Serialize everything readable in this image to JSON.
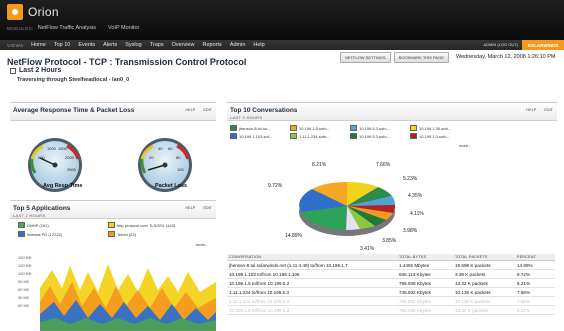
{
  "app": {
    "name": "Orion"
  },
  "modules": {
    "label": "MODULES:",
    "items": [
      "NetFlow Traffic Analysis",
      "VoIP Monitor"
    ]
  },
  "views": {
    "label": "VIEWS:",
    "items": [
      "Home",
      "Top 10",
      "Events",
      "Alerts",
      "Syslog",
      "Traps",
      "Overview",
      "Reports",
      "Admin",
      "Help"
    ]
  },
  "session": {
    "admin": "ADMIN (LOG OUT)",
    "brand": "SOLARWINDS"
  },
  "page": {
    "title": "NetFlow Protocol - TCP : Transmission Control Protocol",
    "period": "Last 2 Hours",
    "through": "Traversing through Steelheadlocal - lan0_0",
    "date": "Wednesday, March 12, 2008 1:26:10 PM",
    "netflow_settings": "NETFLOW SETTINGS",
    "bookmark": "BOOKMARK THIS PAGE"
  },
  "panels": {
    "response": {
      "title": "Average Response Time & Packet Loss",
      "help": "HELP",
      "edit": "EDIT",
      "gauge1": {
        "label": "Avg Resp Time",
        "ticks": [
          "1000",
          "1500",
          "500",
          "2000",
          "2500"
        ]
      },
      "gauge2": {
        "label": "Packet Loss",
        "ticks": [
          "40",
          "60",
          "20",
          "80",
          "100"
        ]
      }
    },
    "conversations": {
      "title": "Top 10 Conversations",
      "subtitle": "LAST 2 HOURS",
      "help": "HELP",
      "edit": "EDIT",
      "more": "more...",
      "legend": [
        {
          "label": "jhenson-8.tul.so...",
          "color": "#2e8b45"
        },
        {
          "label": "10.199.1.5.sofo...",
          "color": "#f5a623"
        },
        {
          "label": "10.199.5.3.sofo...",
          "color": "#4fa3d8"
        },
        {
          "label": "10.199.1.30.sofr...",
          "color": "#f2d21b"
        },
        {
          "label": "10.199.1.103.sof...",
          "color": "#2f6fc9"
        },
        {
          "label": "1.11.1.234.sofo...",
          "color": "#8dc63f"
        },
        {
          "label": "10.199.5.3.sofo...",
          "color": "#1d7a3a"
        },
        {
          "label": "10.199.1.3.sofo...",
          "color": "#b22222"
        }
      ],
      "pie_labels": [
        "8.21%",
        "7.66%",
        "9.72%",
        "5.23%",
        "4.35%",
        "4.11%",
        "3.98%",
        "3.85%",
        "3.41%",
        "14.89%"
      ]
    },
    "apps": {
      "title": "Top 5 Applications",
      "subtitle": "LAST 2 HOURS",
      "help": "HELP",
      "edit": "EDIT",
      "more": "more...",
      "legend": [
        {
          "label": "DNHP (161)",
          "color": "#4fa34f"
        },
        {
          "label": "http protocol over TLS/SSL (443)",
          "color": "#f2d21b"
        },
        {
          "label": "Internal PO (12222)",
          "color": "#2f6fc9"
        },
        {
          "label": "Telnet (23)",
          "color": "#f39a1e"
        }
      ],
      "y_ticks": [
        "150 KB",
        "120 KB",
        "100 KB",
        "90 KB",
        "60 KB",
        "30 KB",
        "60 KB"
      ]
    }
  },
  "table": {
    "headers": [
      "CONVERSATION",
      "TOTAL BYTES",
      "TOTAL PACKETS",
      "PERCENT"
    ],
    "rows": [
      [
        "jhenson-8.tul.solarwinds.net (1.11.4.49) to/from 10.199.1.7",
        "1.4492 Mbytes",
        "19.598 K packets",
        "14.89%"
      ],
      [
        "10.199.1.103 to/from 10.199.1.106",
        "946.113 Kbytes",
        "3.39 K packets",
        "9.72%"
      ],
      [
        "10.199.1.5 to/from 10.199.5.2",
        "798.938 Kbytes",
        "13.32 K packets",
        "8.21%"
      ],
      [
        "1.11.1.234 to/from 10.199.5.3",
        "745.932 Kbytes",
        "10.136 K packets",
        "7.66%"
      ],
      [
        "1.11.1.234 to/from 10.199.5.3",
        "745.932 Kbytes",
        "10.136 K packets",
        "7.66%"
      ],
      [
        "10.199.1.5 to/from 10.199.5.2",
        "798.938 Kbytes",
        "13.32 K packets",
        "8.21%"
      ]
    ]
  }
}
